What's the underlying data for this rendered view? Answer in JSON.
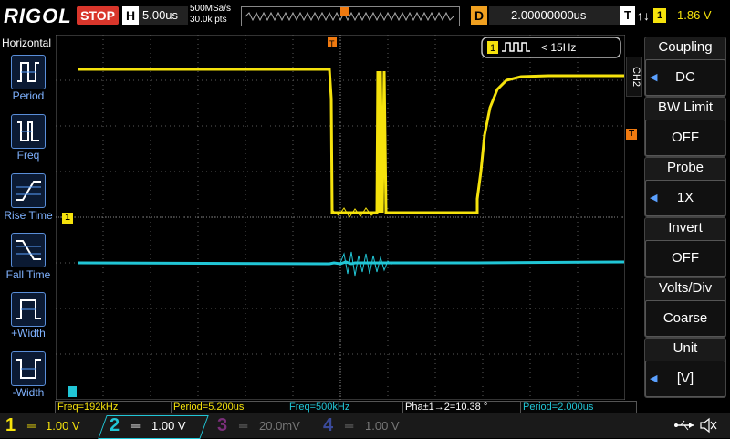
{
  "brand": "RIGOL",
  "run_state": "STOP",
  "horizontal": {
    "label": "H",
    "scale": "5.00us",
    "sample_rate": "500MSa/s",
    "memory_depth": "30.0k pts"
  },
  "delay": {
    "label": "D",
    "value": "2.00000000us"
  },
  "trigger": {
    "label": "T",
    "slope": "↑↓",
    "source": "1",
    "level": "1.86 V"
  },
  "left_panel": {
    "title": "Horizontal",
    "items": [
      {
        "label": "Period"
      },
      {
        "label": "Freq"
      },
      {
        "label": "Rise Time"
      },
      {
        "label": "Fall Time"
      },
      {
        "label": "+Width"
      },
      {
        "label": "-Width"
      }
    ]
  },
  "trigger_status": {
    "channel": "1",
    "text": "< 15Hz"
  },
  "right_panel": {
    "channel_tag": "CH2",
    "items": [
      {
        "title": "Coupling",
        "value": "DC"
      },
      {
        "title": "BW Limit",
        "value": "OFF"
      },
      {
        "title": "Probe",
        "value": "1X"
      },
      {
        "title": "Invert",
        "value": "OFF"
      },
      {
        "title": "Volts/Div",
        "value": "Coarse"
      },
      {
        "title": "Unit",
        "value": "[V]"
      }
    ]
  },
  "measurements": [
    {
      "text": "Freq=192kHz"
    },
    {
      "text": "Period=5.200us"
    },
    {
      "text": "Freq=500kHz"
    },
    {
      "text": "Pha±1→2=10.38 °"
    },
    {
      "text": "Period=2.000us"
    }
  ],
  "channels": [
    {
      "num": "1",
      "coupling": "═",
      "scale": "1.00 V",
      "color": "#f5e20c"
    },
    {
      "num": "2",
      "coupling": "═",
      "scale": "1.00 V",
      "color": "#21c6d6"
    },
    {
      "num": "3",
      "coupling": "═",
      "scale": "20.0mV",
      "color": "#c040c0"
    },
    {
      "num": "4",
      "coupling": "═",
      "scale": "1.00 V",
      "color": "#3050e0"
    }
  ],
  "markers": {
    "trigger_pos": "T",
    "ch1_marker": "1",
    "ch2_marker": "2",
    "trig_level_marker": "T"
  },
  "colors": {
    "ch1": "#f5e20c",
    "ch2": "#21c6d6",
    "trigger": "#f07a10",
    "grid": "#5a5a5a"
  }
}
